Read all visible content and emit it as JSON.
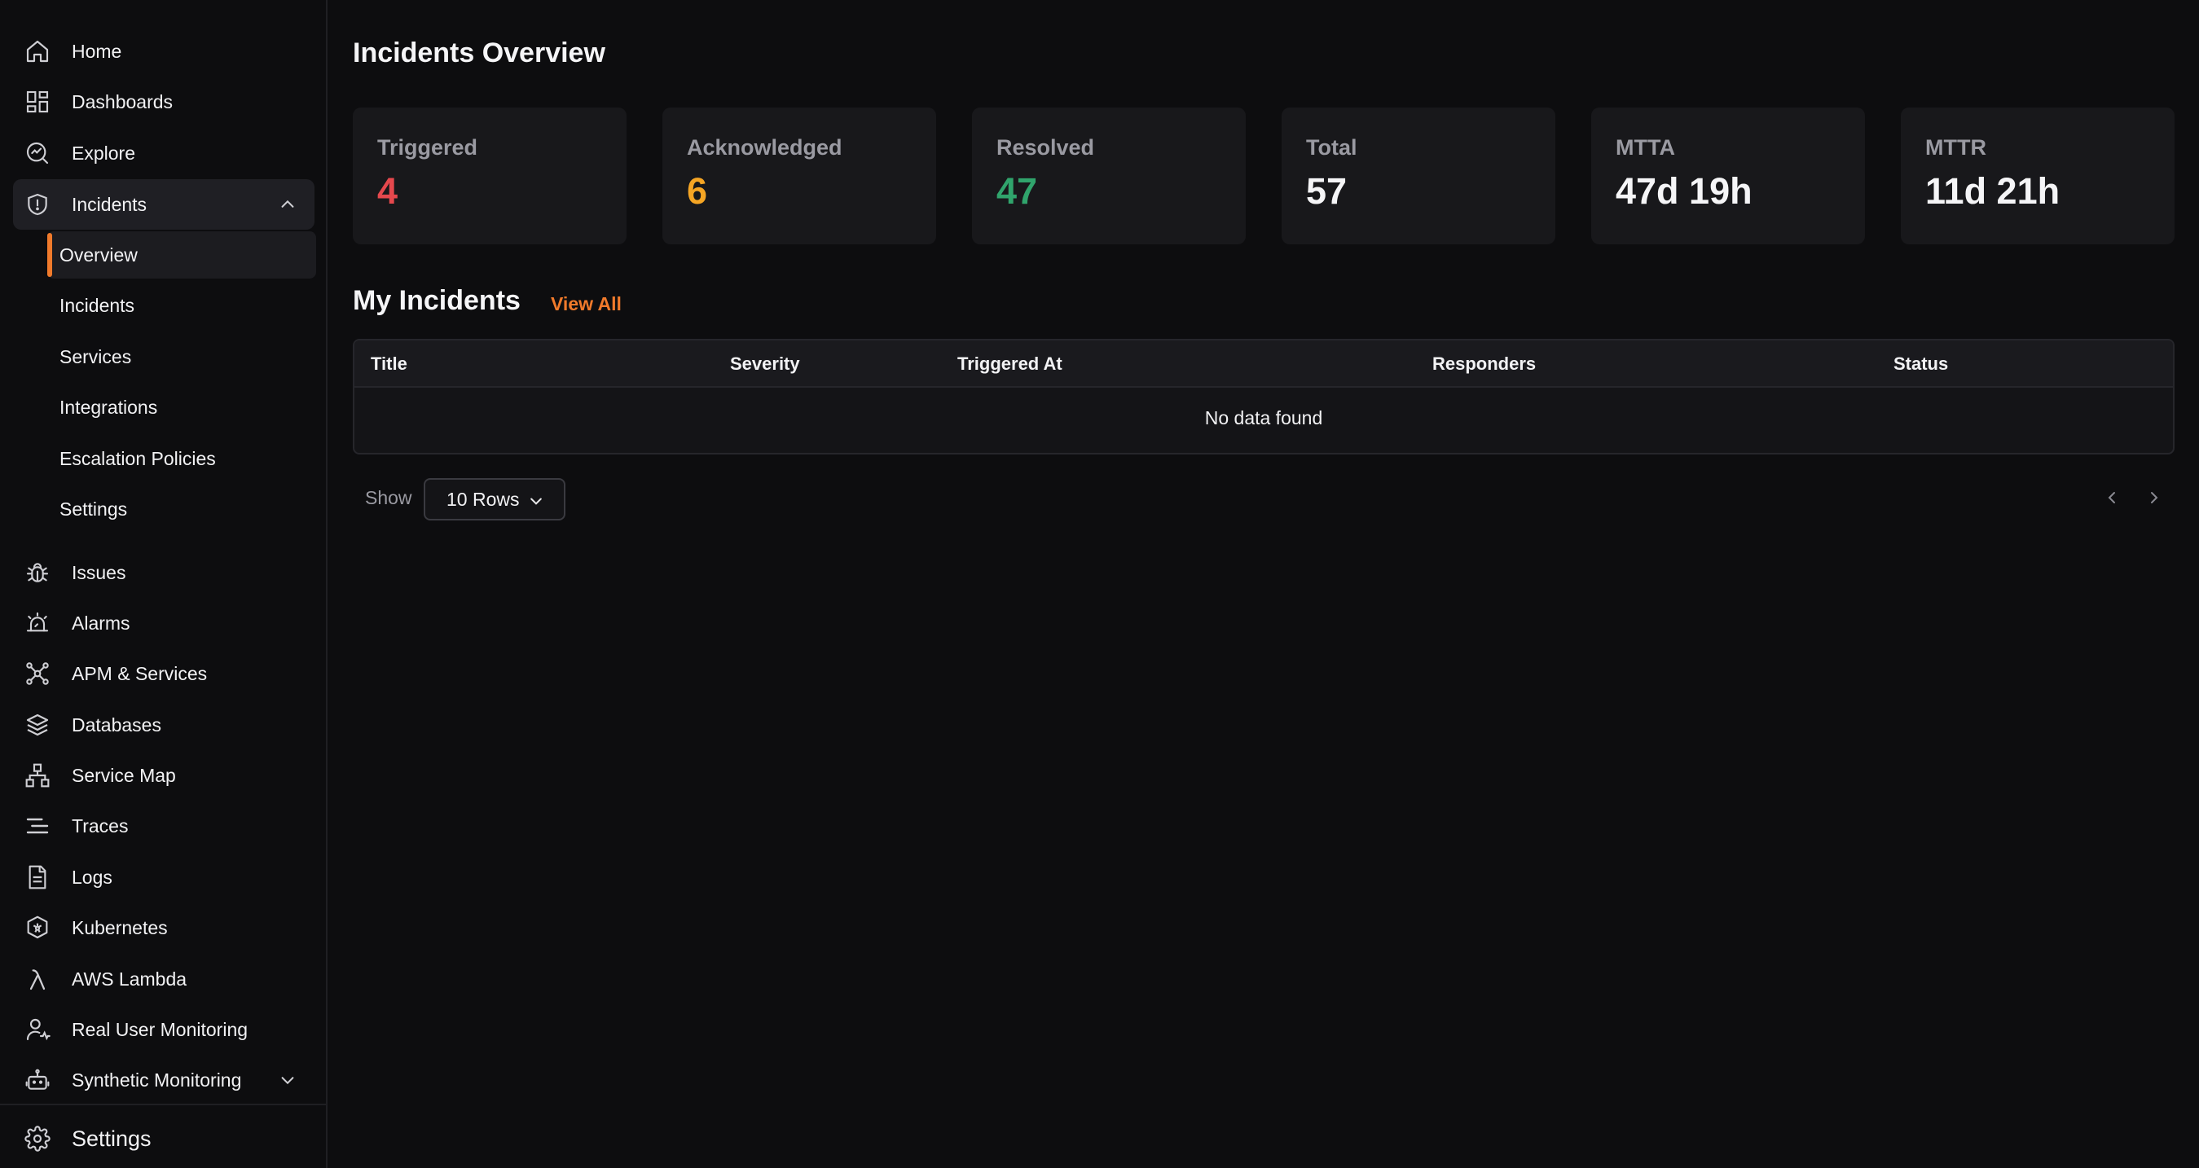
{
  "sidebar": {
    "top_items": [
      {
        "label": "Home",
        "icon": "home-icon"
      },
      {
        "label": "Dashboards",
        "icon": "dashboards-icon"
      },
      {
        "label": "Explore",
        "icon": "explore-icon"
      },
      {
        "label": "Incidents",
        "icon": "shield-icon",
        "expanded": true
      }
    ],
    "incident_subitems": [
      {
        "label": "Overview",
        "selected": true
      },
      {
        "label": "Incidents"
      },
      {
        "label": "Services"
      },
      {
        "label": "Integrations"
      },
      {
        "label": "Escalation Policies"
      },
      {
        "label": "Settings"
      }
    ],
    "bottom_items": [
      {
        "label": "Issues",
        "icon": "bug-icon"
      },
      {
        "label": "Alarms",
        "icon": "alarm-icon"
      },
      {
        "label": "APM & Services",
        "icon": "apm-icon"
      },
      {
        "label": "Databases",
        "icon": "database-icon"
      },
      {
        "label": "Service Map",
        "icon": "service-map-icon"
      },
      {
        "label": "Traces",
        "icon": "traces-icon"
      },
      {
        "label": "Logs",
        "icon": "logs-icon"
      },
      {
        "label": "Kubernetes",
        "icon": "kubernetes-icon"
      },
      {
        "label": "AWS Lambda",
        "icon": "lambda-icon"
      },
      {
        "label": "Real User Monitoring",
        "icon": "user-monitoring-icon"
      },
      {
        "label": "Synthetic Monitoring",
        "icon": "robot-icon",
        "expandable": true
      }
    ],
    "footer": {
      "label": "Settings",
      "icon": "gear-icon"
    }
  },
  "main": {
    "title": "Incidents Overview",
    "stats": [
      {
        "label": "Triggered",
        "value": "4",
        "color": "#e5484d"
      },
      {
        "label": "Acknowledged",
        "value": "6",
        "color": "#f5a524"
      },
      {
        "label": "Resolved",
        "value": "47",
        "color": "#30a46c"
      },
      {
        "label": "Total",
        "value": "57",
        "color": "#f5f5f7"
      },
      {
        "label": "MTTA",
        "value": "47d 19h",
        "color": "#f5f5f7"
      },
      {
        "label": "MTTR",
        "value": "11d 21h",
        "color": "#f5f5f7"
      }
    ],
    "my_incidents": {
      "title": "My Incidents",
      "view_all": "View All",
      "columns": [
        "Title",
        "Severity",
        "Triggered At",
        "Responders",
        "Status"
      ],
      "empty_text": "No data found",
      "show_label": "Show",
      "rows_option": "10 Rows"
    }
  },
  "colors": {
    "accent": "#f07a2b",
    "background": "#0d0d0f",
    "card": "#18181b"
  }
}
